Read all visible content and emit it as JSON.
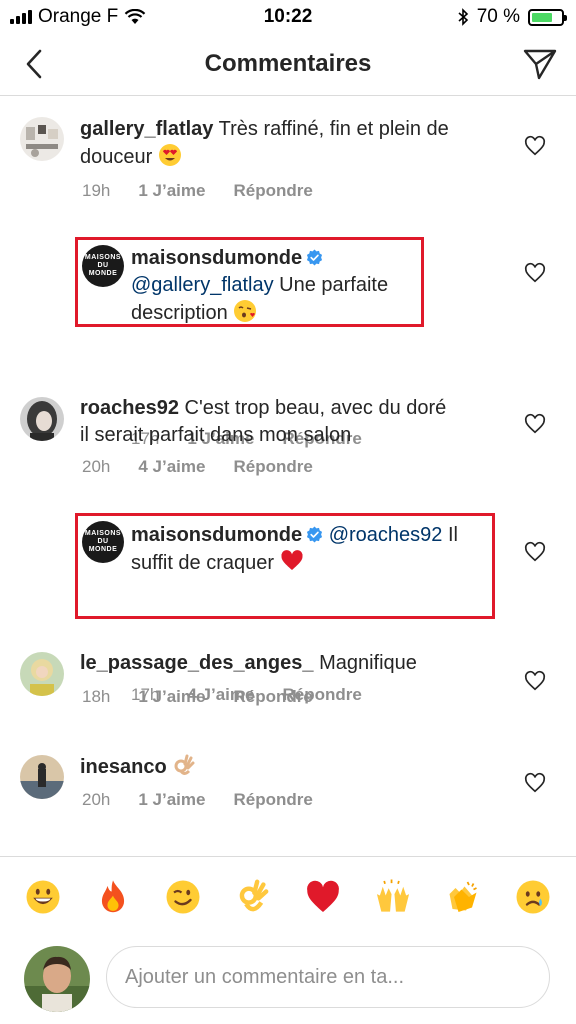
{
  "status": {
    "carrier": "Orange F",
    "time": "10:22",
    "battery": "70 %",
    "battery_level": 0.7
  },
  "header": {
    "title": "Commentaires"
  },
  "comments": [
    {
      "user": "gallery_flatlay",
      "text": "Très raffiné, fin et plein de",
      "text2": "douceur",
      "time": "19h",
      "likes": "1 J’aime",
      "reply": "Répondre"
    },
    {
      "user": "maisonsdumonde",
      "mention": "@gallery_flatlay",
      "text": " Une parfaite",
      "text2": "description",
      "time": "17h",
      "likes": "1 J’aime",
      "reply": "Répondre"
    },
    {
      "user": "roaches92",
      "text": "C'est trop beau, avec du doré",
      "text2": "il serait parfait dans mon salon",
      "time": "20h",
      "likes": "4 J’aime",
      "reply": "Répondre"
    },
    {
      "user": "maisonsdumonde",
      "mention": "@roaches92",
      "text": " Il",
      "text2": "suffit de craquer",
      "time": "17h",
      "likes": "4 J’aime",
      "reply": "Répondre"
    },
    {
      "user": "le_passage_des_anges_",
      "text": "Magnifique",
      "time": "18h",
      "likes": "1 J’aime",
      "reply": "Répondre"
    },
    {
      "user": "inesanco",
      "text": "",
      "time": "20h",
      "likes": "1 J’aime",
      "reply": "Répondre"
    }
  ],
  "logo_text": "MAISONS DU MONDE",
  "composer": {
    "placeholder": "Ajouter un commentaire en ta..."
  },
  "colors": {
    "mention": "#003569",
    "verified": "#3897f0",
    "highlight": "#e0192a",
    "meta": "#8e8e8e"
  }
}
